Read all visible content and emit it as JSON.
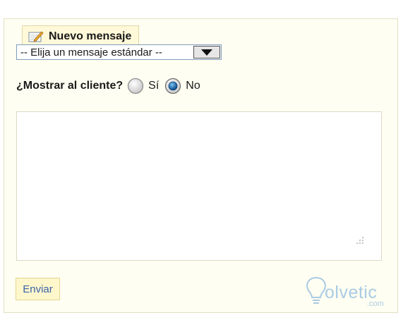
{
  "panel": {
    "title": "Nuevo mensaje",
    "title_icon": "note-pencil-icon"
  },
  "message_select": {
    "selected_label": "-- Elija un mensaje estándar --"
  },
  "show_to_client": {
    "question": "¿Mostrar al cliente?",
    "options": [
      {
        "label": "Sí",
        "checked": false
      },
      {
        "label": "No",
        "checked": true
      }
    ]
  },
  "message_body": {
    "value": ""
  },
  "actions": {
    "send_label": "Enviar"
  },
  "watermark": {
    "text": "olvetic",
    "domain": ".com"
  },
  "colors": {
    "panel_bg": "#fffef2",
    "legend_bg": "#fff9d9",
    "button_text": "#3b63a8",
    "radio_selected": "#1f6fb8",
    "watermark": "#a9cbe3"
  }
}
